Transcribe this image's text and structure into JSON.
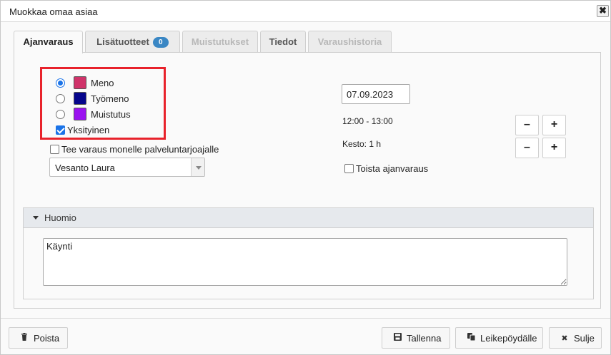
{
  "dialog": {
    "title": "Muokkaa omaa asiaa",
    "close_symbol": "✖"
  },
  "tabs": [
    {
      "label": "Ajanvaraus",
      "state": "active"
    },
    {
      "label": "Lisätuotteet",
      "badge": "0",
      "state": "normal"
    },
    {
      "label": "Muistutukset",
      "state": "disabled"
    },
    {
      "label": "Tiedot",
      "state": "normal"
    },
    {
      "label": "Varaushistoria",
      "state": "disabled"
    }
  ],
  "booking_types": [
    {
      "label": "Meno",
      "color": "#d0336a",
      "selected": true
    },
    {
      "label": "Työmeno",
      "color": "#05058c",
      "selected": false
    },
    {
      "label": "Muistutus",
      "color": "#9a12f0",
      "selected": false
    }
  ],
  "private_checkbox": {
    "label": "Yksityinen",
    "checked": true
  },
  "multi_provider_checkbox": {
    "label": "Tee varaus monelle palveluntarjoajalle",
    "checked": false
  },
  "provider_select": {
    "value": "Vesanto Laura"
  },
  "date": {
    "value": "07.09.2023"
  },
  "time_range": "12:00 - 13:00",
  "duration": "Kesto: 1 h",
  "repeat_checkbox": {
    "label": "Toista ajanvaraus",
    "checked": false
  },
  "steppers": {
    "minus": "–",
    "plus": "+"
  },
  "notes": {
    "title": "Huomio",
    "value": "Käynti"
  },
  "footer": {
    "delete_label": "Poista",
    "save_label": "Tallenna",
    "clipboard_label": "Leikepöydälle",
    "close_label": "Sulje"
  },
  "colors": {
    "accent": "#1a73e8",
    "badge": "#3a87c4",
    "highlight": "#e8222b"
  }
}
